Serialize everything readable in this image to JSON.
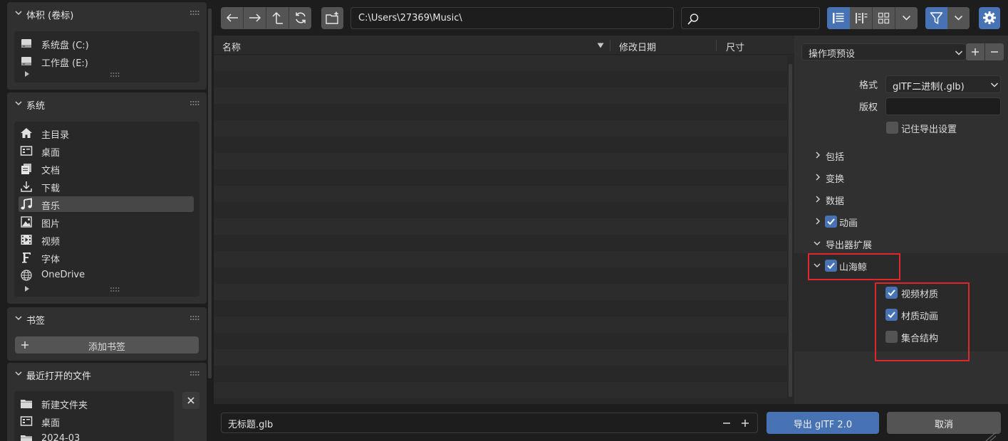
{
  "sidebar": {
    "volumes": {
      "title": "体积 (卷标)",
      "items": [
        {
          "label": "系统盘 (C:)",
          "icon": "drive-icon"
        },
        {
          "label": "工作盘 (E:)",
          "icon": "drive-icon"
        }
      ]
    },
    "system": {
      "title": "系统",
      "items": [
        {
          "label": "主目录",
          "icon": "home-icon"
        },
        {
          "label": "桌面",
          "icon": "desktop-icon"
        },
        {
          "label": "文档",
          "icon": "documents-icon"
        },
        {
          "label": "下载",
          "icon": "download-icon"
        },
        {
          "label": "音乐",
          "icon": "music-icon",
          "active": true
        },
        {
          "label": "图片",
          "icon": "image-icon"
        },
        {
          "label": "视频",
          "icon": "video-icon"
        },
        {
          "label": "字体",
          "icon": "font-icon"
        },
        {
          "label": "OneDrive",
          "icon": "globe-icon"
        }
      ]
    },
    "bookmarks": {
      "title": "书签",
      "add_label": "添加书签"
    },
    "recent": {
      "title": "最近打开的文件",
      "items": [
        {
          "label": "新建文件夹",
          "icon": "folder-icon"
        },
        {
          "label": "桌面",
          "icon": "desktop-icon"
        },
        {
          "label": "2024-03",
          "icon": "folder-icon"
        }
      ]
    }
  },
  "toolbar": {
    "path": "C:\\Users\\27369\\Music\\",
    "search_value": ""
  },
  "filelist": {
    "columns": {
      "name": "名称",
      "date": "修改日期",
      "size": "尺寸"
    },
    "rows": []
  },
  "operator": {
    "preset_label": "操作项预设",
    "format_label": "格式",
    "format_value": "glTF二进制(.glb)",
    "copyright_label": "版权",
    "copyright_value": "",
    "remember_label": "记住导出设置",
    "remember_checked": false,
    "sections": {
      "include": "包括",
      "transform": "变换",
      "data": "数据",
      "animation": "动画",
      "extensions": "导出器扩展",
      "shanhaijing": "山海鲸"
    },
    "animation_checked": true,
    "shanhaijing_checked": true,
    "options": {
      "video_material": {
        "label": "视频材质",
        "checked": true
      },
      "material_animation": {
        "label": "材质动画",
        "checked": true
      },
      "collection_structure": {
        "label": "集合结构",
        "checked": false
      }
    }
  },
  "bottom": {
    "filename": "无标题.glb",
    "export_label": "导出 glTF 2.0",
    "cancel_label": "取消"
  },
  "colors": {
    "accent": "#4772b3",
    "highlight": "#e0262a",
    "background": "#1d1d1d",
    "panel": "#303030"
  }
}
